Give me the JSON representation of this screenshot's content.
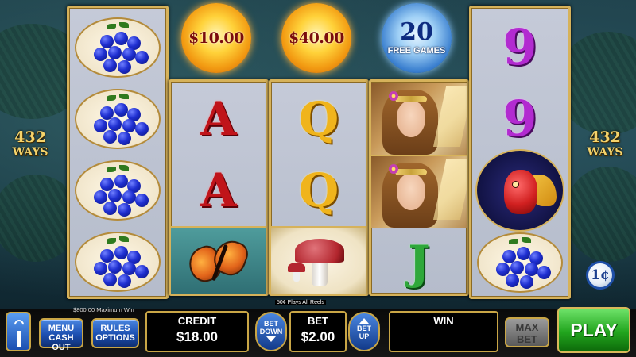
{
  "jackpots": [
    {
      "label": "$10.00"
    },
    {
      "label": "$40.00"
    }
  ],
  "free_games": {
    "count": "20",
    "label": "FREE GAMES"
  },
  "ways": {
    "count": "432",
    "label": "WAYS"
  },
  "reels": [
    [
      "blueberries",
      "blueberries",
      "blueberries",
      "blueberries"
    ],
    [
      "A",
      "A",
      "butterfly"
    ],
    [
      "Q",
      "Q",
      "mushroom"
    ],
    [
      "fairy",
      "fairy",
      "J"
    ],
    [
      "9",
      "9",
      "dragon",
      "blueberries"
    ]
  ],
  "denomination": "1¢",
  "max_win_note": "$800.00 Maximum Win",
  "plays_note": "50¢ Plays All Reels",
  "controls": {
    "menu": {
      "line1": "MENU",
      "line2": "CASH OUT"
    },
    "rules": {
      "line1": "RULES",
      "line2": "OPTIONS"
    },
    "credit": {
      "label": "CREDIT",
      "value": "$18.00"
    },
    "bet_down": {
      "line1": "BET",
      "line2": "DOWN"
    },
    "bet": {
      "label": "BET",
      "value": "$2.00"
    },
    "bet_up": {
      "line1": "BET",
      "line2": "UP"
    },
    "win": {
      "label": "WIN",
      "value": ""
    },
    "max_bet": {
      "line1": "MAX",
      "line2": "BET"
    },
    "play": "PLAY"
  }
}
